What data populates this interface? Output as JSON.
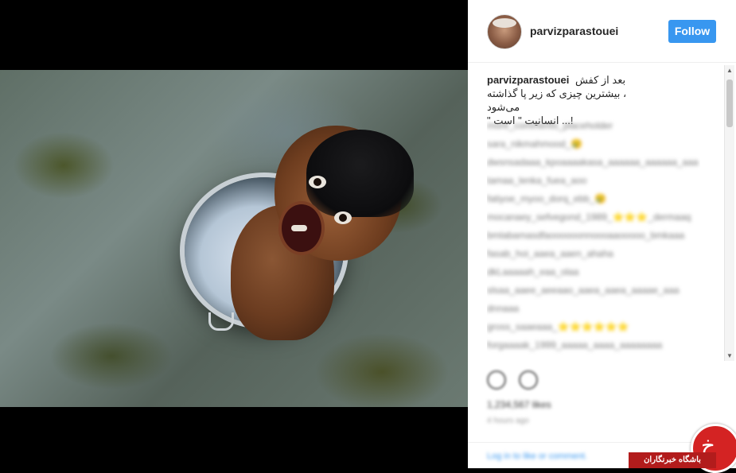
{
  "header": {
    "username": "parvizparastouei",
    "follow_label": "Follow"
  },
  "caption": {
    "username": "parvizparastouei",
    "line1": "بعد از کفش",
    "line2": "، بیشترین چیزی که زیر پا گذاشته می‌شود",
    "line3": "!... انسانیت \" است \""
  },
  "comments": [
    "more_comments_placeholder",
    "sara_nikmahmood_😢",
    "dwsnsadaaa_kpoaaaakasa_aaaaaa_aaaaaa_aaa",
    "tamaa_lenka_fuea_aoo",
    "fatiyoe_myoo_dorq_ebb_😢",
    "mocanaey_sefvegond_1989_⭐⭐⭐_dermaaq",
    "bmlabamasdfaoooooonnoooaaooooo_bmkaaa",
    "fasab_hoi_aaea_aaen_ahaha",
    "dkLaaaaah_eaa_olaa",
    "slsaa_aaee_aeeaao_aaea_aaea_aaaae_aaa",
    "dnnaaa",
    "gross_saaeaaa_⭐⭐⭐⭐⭐⭐",
    "forgaaaak_1999_aaaaa_aaaa_aaaaaaaa"
  ],
  "engagement": {
    "likes": "1,234,567 likes",
    "time": "4 hours ago"
  },
  "footer": {
    "login_text": "Log in to like or comment."
  },
  "watermark": {
    "label": "باشگاه خبرنگاران",
    "glyph": "خ"
  },
  "colors": {
    "follow_button": "#3897f0",
    "watermark_red": "#b21c1c"
  }
}
